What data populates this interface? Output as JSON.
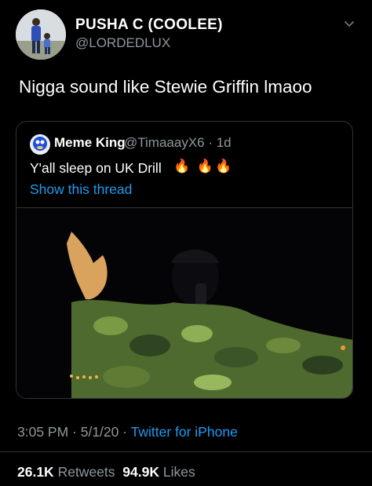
{
  "tweet": {
    "display_name": "PUSHA C (COOLEE)",
    "handle": "@LORDEDLUX",
    "text": "Nigga sound like Stewie Griffin lmaoo",
    "timestamp": "3:05 PM · 5/1/20 · ",
    "source": "Twitter for iPhone",
    "retweet_count": "26.1K",
    "retweet_label": "Retweets",
    "like_count": "94.9K",
    "like_label": "Likes"
  },
  "quoted": {
    "display_name": "Meme King",
    "handle_time": "@TimaaayX6 · 1d",
    "text": "Y'all sleep on UK Drill",
    "emoji": "🔥 🔥🔥",
    "show_thread": "Show this thread"
  },
  "icons": {
    "more": "chevron-down-icon",
    "media": "video-still"
  },
  "colors": {
    "link": "#1d9bf0",
    "secondary_text": "#8e979e",
    "divider": "#2f3336"
  }
}
